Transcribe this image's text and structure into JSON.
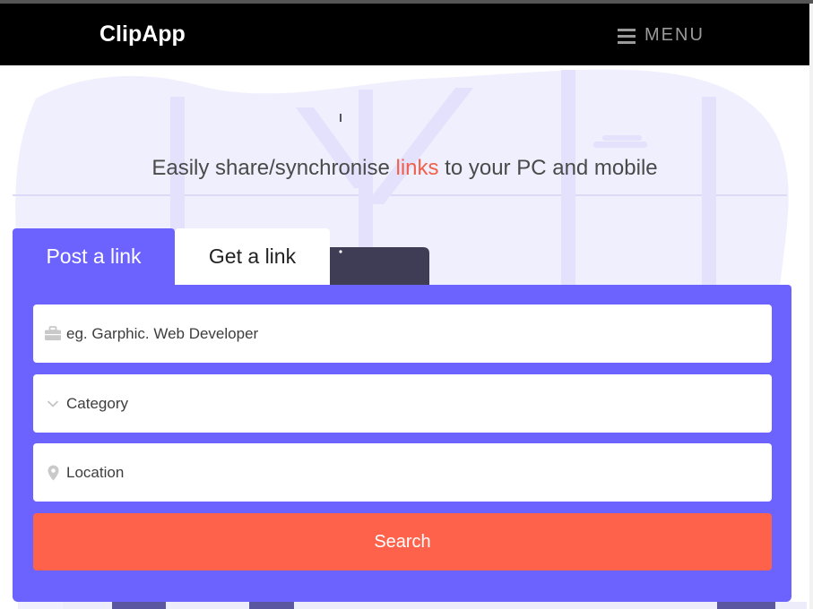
{
  "brand": {
    "name": "ClipApp"
  },
  "nav": {
    "menu_label": "MENU",
    "menu_icon": "hamburger-icon"
  },
  "hero": {
    "tagline_before": "Easily share/synchronise ",
    "tagline_accent": "links",
    "tagline_after": " to your PC and mobile"
  },
  "tabs": [
    {
      "label": "Post a link",
      "active": true
    },
    {
      "label": "Get a link",
      "active": false
    }
  ],
  "form": {
    "keyword": {
      "placeholder": "eg. Garphic. Web Developer",
      "icon": "briefcase-icon"
    },
    "category": {
      "label": "Category",
      "icon": "chevron-down-icon"
    },
    "location": {
      "placeholder": "Location",
      "icon": "map-pin-icon"
    },
    "search_label": "Search"
  },
  "colors": {
    "navbar": "#000000",
    "primary": "#6c63ff",
    "accent": "#ff624a",
    "tagline_accent": "#f0604a"
  }
}
